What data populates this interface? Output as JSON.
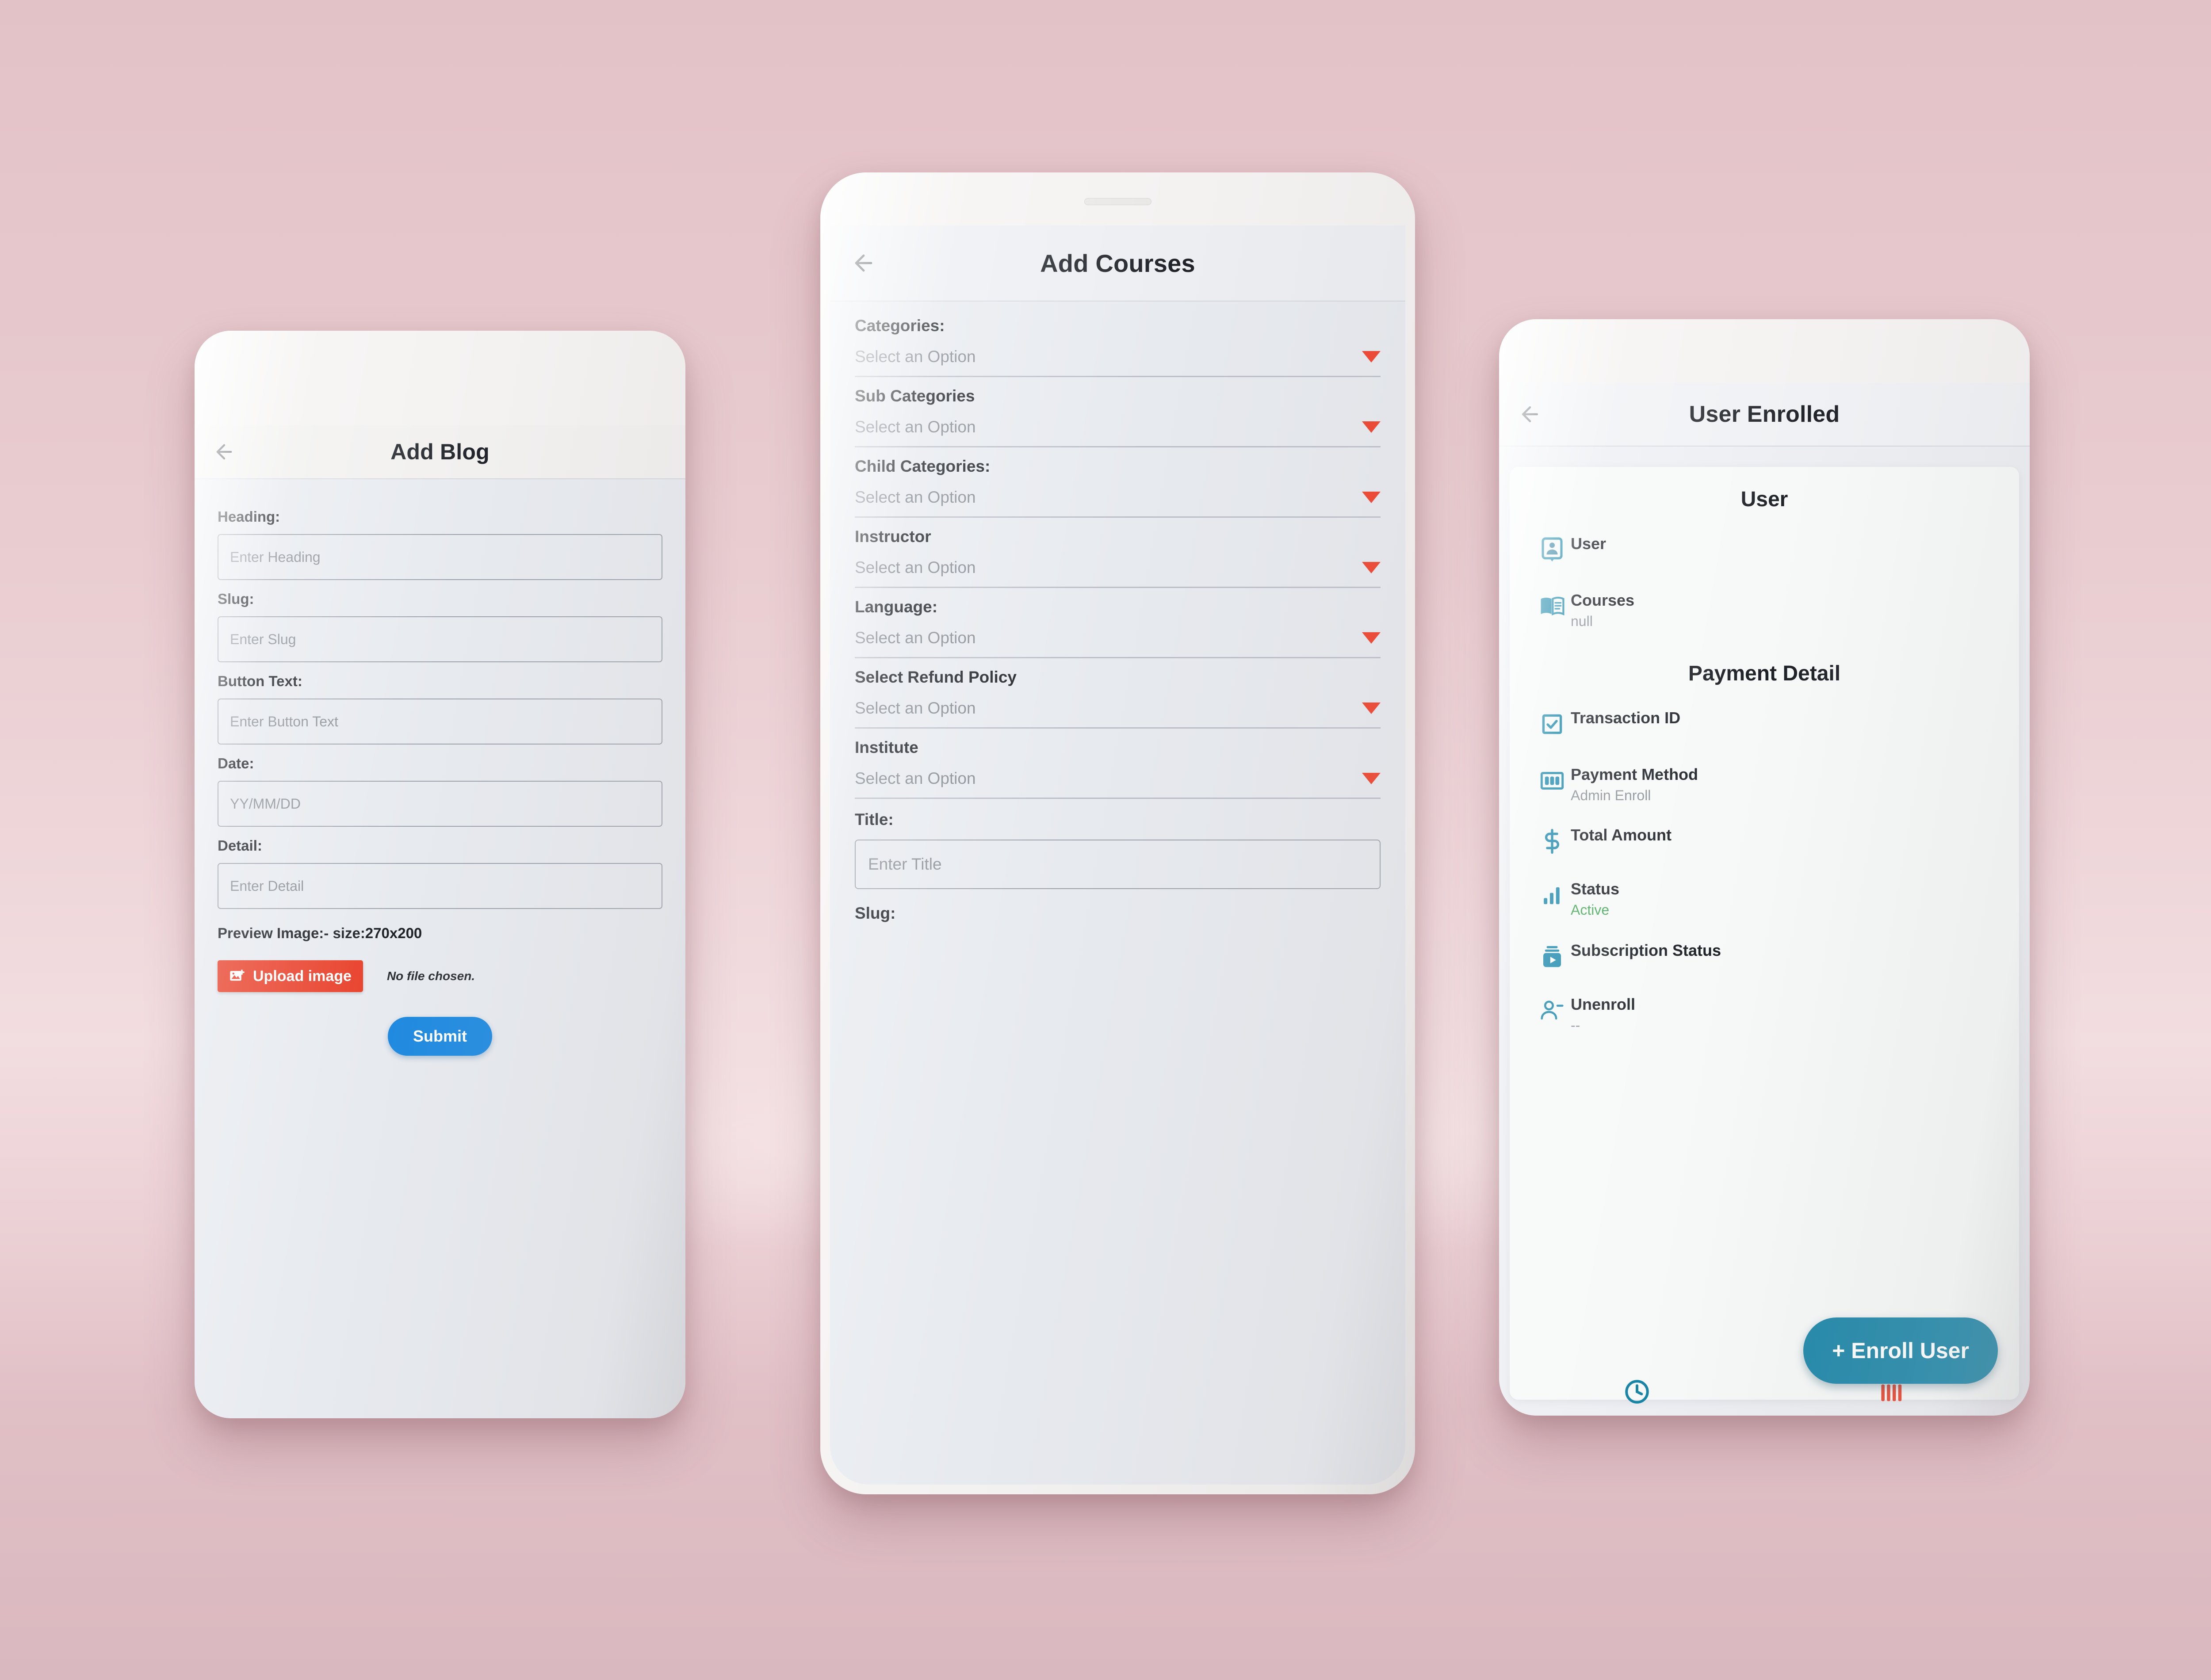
{
  "theme": {
    "background_pink": "#e6c8cc",
    "phone_body": "#f4f2f1",
    "screen_bg": "#e7eaef",
    "appbar_bg": "#eaecf1",
    "accent_red": "#e8402a",
    "caret_red": "#ef3b24",
    "submit_blue": "#1f8ae0",
    "teal": "#1c88ac",
    "fab_teal": "#1884a6",
    "status_green": "#47a859"
  },
  "phones": [
    {
      "id": "add-blog",
      "appbar": {
        "back_icon": "arrow-left-icon",
        "title": "Add Blog"
      },
      "fields": [
        {
          "label": "Heading:",
          "placeholder": "Enter Heading",
          "name": "heading"
        },
        {
          "label": "Slug:",
          "placeholder": "Enter Slug",
          "name": "slug"
        },
        {
          "label": "Button Text:",
          "placeholder": "Enter Button Text",
          "name": "button-text"
        },
        {
          "label": "Date:",
          "placeholder": "YY/MM/DD",
          "name": "date"
        },
        {
          "label": "Detail:",
          "placeholder": "Enter Detail",
          "name": "detail"
        }
      ],
      "preview_note": "Preview Image:- size:270x200",
      "upload": {
        "icon": "image-add-icon",
        "label": "Upload image",
        "file_status": "No file chosen."
      },
      "submit": {
        "label": "Submit"
      }
    },
    {
      "id": "add-courses",
      "appbar": {
        "back_icon": "arrow-left-icon",
        "title": "Add Courses"
      },
      "selects": [
        {
          "label": "Categories:",
          "value": "Select an Option",
          "name": "categories"
        },
        {
          "label": "Sub Categories",
          "value": "Select an Option",
          "name": "sub-categories"
        },
        {
          "label": "Child Categories:",
          "value": "Select an Option",
          "name": "child-categories"
        },
        {
          "label": "Instructor",
          "value": "Select an Option",
          "name": "instructor"
        },
        {
          "label": "Language:",
          "value": "Select an Option",
          "name": "language"
        },
        {
          "label": "Select Refund Policy",
          "value": "Select an Option",
          "name": "refund-policy"
        },
        {
          "label": "Institute",
          "value": "Select an Option",
          "name": "institute"
        }
      ],
      "text_fields": [
        {
          "label": "Title:",
          "placeholder": "Enter Title",
          "name": "title"
        }
      ],
      "trailing_label": "Slug:"
    },
    {
      "id": "user-enrolled",
      "appbar": {
        "back_icon": "arrow-left-icon",
        "title": "User Enrolled"
      },
      "sections": [
        {
          "heading": "User",
          "rows": [
            {
              "icon": "id-badge-icon",
              "title": "User",
              "sub": ""
            },
            {
              "icon": "open-book-icon",
              "title": "Courses",
              "sub": "null"
            }
          ]
        },
        {
          "heading": "Payment Detail",
          "rows": [
            {
              "icon": "checkbox-checked-icon",
              "title": "Transaction ID",
              "sub": ""
            },
            {
              "icon": "banknote-icon",
              "title": "Payment Method",
              "sub": "Admin Enroll"
            },
            {
              "icon": "dollar-sign-icon",
              "title": "Total Amount",
              "sub": ""
            },
            {
              "icon": "bar-chart-icon",
              "title": "Status",
              "sub": "Active",
              "sub_style": "status-active"
            },
            {
              "icon": "subscription-play-icon",
              "title": "Subscription Status",
              "sub": ""
            },
            {
              "icon": "user-minus-icon",
              "title": "Unenroll",
              "sub": "--"
            }
          ]
        }
      ],
      "fab": {
        "label": "+ Enroll User"
      },
      "bottom_bar": [
        {
          "icon": "clock-icon",
          "color": "#1884a6"
        },
        {
          "icon": "bars-icon",
          "color": "#e8402a"
        }
      ]
    }
  ]
}
